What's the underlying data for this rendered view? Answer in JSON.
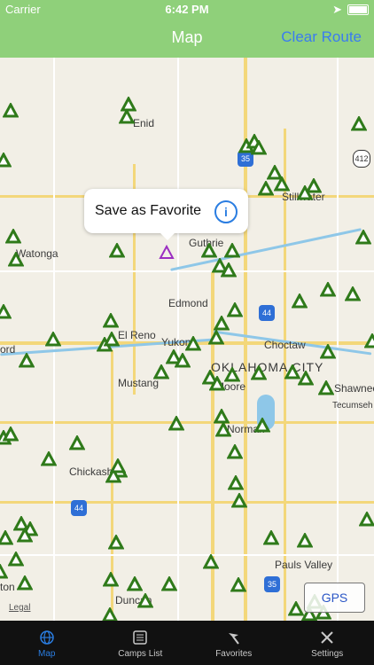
{
  "status_bar": {
    "carrier": "Carrier",
    "time": "6:42 PM"
  },
  "navbar": {
    "title": "Map",
    "clear_route": "Clear Route"
  },
  "map": {
    "popup": {
      "label": "Save as Favorite",
      "info": "i"
    },
    "places": [
      "Enid",
      "Stillwater",
      "Watonga",
      "Guthrie",
      "Edmond",
      "El Reno",
      "Yukon",
      "Choctaw",
      "Mustang",
      "OKLAHOMA CITY",
      "Moore",
      "Shawnee",
      "Tecumseh",
      "Norman",
      "Chickasha",
      "Pauls Valley",
      "Duncan",
      "ord",
      "ton"
    ],
    "shields": [
      "35",
      "412",
      "44",
      "44",
      "44",
      "35"
    ],
    "pin_color_campsite": "#2f7a1a",
    "pin_color_selected": "#9b2ec2",
    "gps_label": "GPS",
    "legal": "Legal"
  },
  "tabs": [
    {
      "label": "Map",
      "icon": "globe-icon",
      "active": true
    },
    {
      "label": "Camps List",
      "icon": "list-icon",
      "active": false
    },
    {
      "label": "Favorites",
      "icon": "flag-icon",
      "active": false
    },
    {
      "label": "Settings",
      "icon": "tools-icon",
      "active": false
    }
  ]
}
